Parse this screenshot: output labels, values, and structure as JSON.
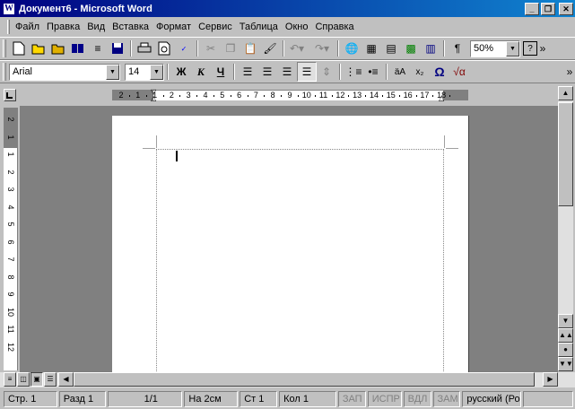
{
  "window": {
    "title": "Документ6 - Microsoft Word",
    "icon": "W"
  },
  "menu": [
    "Файл",
    "Правка",
    "Вид",
    "Вставка",
    "Формат",
    "Сервис",
    "Таблица",
    "Окно",
    "Справка"
  ],
  "standard_toolbar": {
    "zoom": "50%",
    "help": "?"
  },
  "format_toolbar": {
    "font": "Arial",
    "size": "14",
    "bold": "Ж",
    "italic": "К",
    "underline": "Ч",
    "symbol": "Ω",
    "equation": "√α",
    "subscript": "x₂"
  },
  "ruler": {
    "h_ticks": [
      "2",
      "1",
      "1",
      "2",
      "3",
      "4",
      "5",
      "6",
      "7",
      "8",
      "9",
      "10",
      "11",
      "12",
      "13",
      "14",
      "15",
      "16",
      "17",
      "18"
    ],
    "v_ticks": [
      "2",
      "1",
      "1",
      "2",
      "3",
      "4",
      "5",
      "6",
      "7",
      "8",
      "9",
      "10",
      "11",
      "12"
    ]
  },
  "status": {
    "page": "Стр. 1",
    "section": "Разд 1",
    "pages": "1/1",
    "at": "На 2см",
    "line": "Ст 1",
    "col": "Кол 1",
    "rec": "ЗАП",
    "trk": "ИСПР",
    "ext": "ВДЛ",
    "ovr": "ЗАМ",
    "lang": "русский (Ро"
  }
}
